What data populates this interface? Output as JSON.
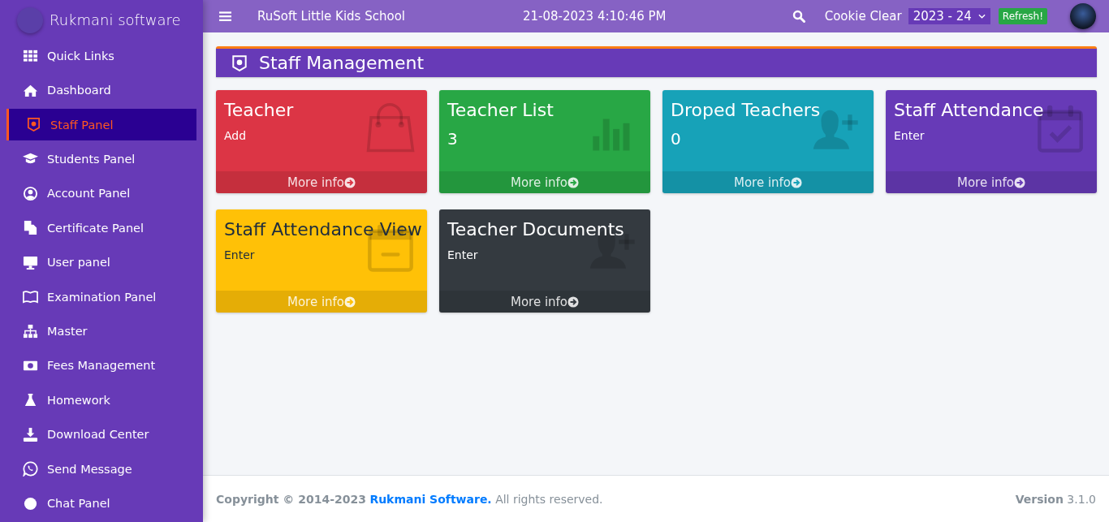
{
  "sidebar": {
    "brand": "Rukmani software",
    "items": [
      {
        "label": "Quick Links",
        "selected": false
      },
      {
        "label": "Dashboard",
        "selected": false
      },
      {
        "label": "Staff Panel",
        "selected": true
      },
      {
        "label": "Students Panel",
        "selected": false
      },
      {
        "label": "Account Panel",
        "selected": false
      },
      {
        "label": "Certificate Panel",
        "selected": false
      },
      {
        "label": "User panel",
        "selected": false
      },
      {
        "label": "Examination Panel",
        "selected": false
      },
      {
        "label": "Master",
        "selected": false
      },
      {
        "label": "Fees Management",
        "selected": false
      },
      {
        "label": "Homework",
        "selected": false
      },
      {
        "label": "Download Center",
        "selected": false
      },
      {
        "label": "Send Message",
        "selected": false
      },
      {
        "label": "Chat Panel",
        "selected": false
      }
    ]
  },
  "topbar": {
    "school": "RuSoft Little Kids School",
    "datetime": "21-08-2023 4:10:46 PM",
    "cookie_clear": "Cookie Clear",
    "session": {
      "value": "2023 - 24"
    },
    "refresh": "Refresh!"
  },
  "page_title": "Staff Management",
  "cards": [
    {
      "title": "Teacher",
      "subtitle": "Add",
      "link": "More info",
      "color": "#dc3545",
      "kind": "bag"
    },
    {
      "title": "Teacher List",
      "subtitle": "3",
      "link": "More info",
      "color": "#28a745",
      "kind": "chart"
    },
    {
      "title": "Droped Teachers",
      "subtitle": "0",
      "link": "More info",
      "color": "#17a2b8",
      "kind": "user-add"
    },
    {
      "title": "Staff Attendance",
      "subtitle": "Enter",
      "link": "More info",
      "color": "#673ab7",
      "kind": "calendar-check"
    },
    {
      "title": "Staff Attendance View",
      "subtitle": "Enter",
      "link": "More info",
      "color": "#ffc107",
      "kind": "calendar-minus"
    },
    {
      "title": "Teacher Documents",
      "subtitle": "Enter",
      "link": "More info",
      "color": "#343a40",
      "kind": "user-add"
    }
  ],
  "footer": {
    "copyright": "**Copyright © 2014-2023**",
    "company_link": "Rukmani Software.",
    "rights": "All rights reserved.",
    "version": "**Version** 3.1.0"
  }
}
